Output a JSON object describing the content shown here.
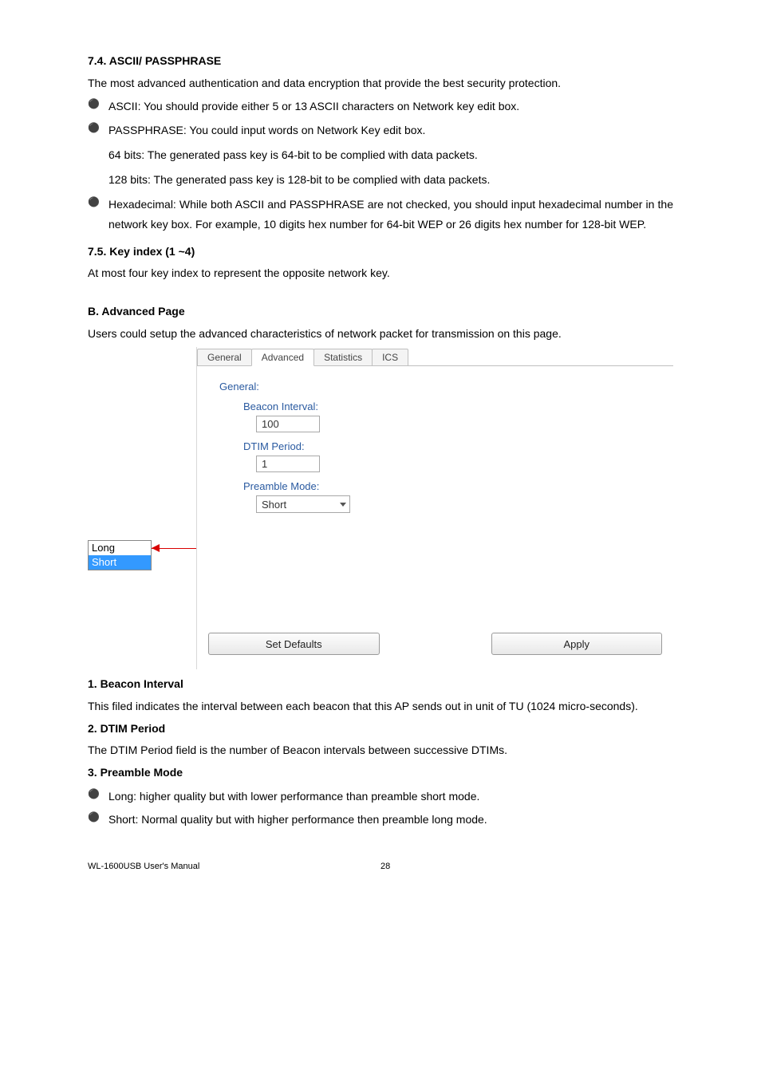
{
  "s74": {
    "heading": "7.4. ASCII/ PASSPHRASE",
    "intro": "The most advanced authentication and data encryption that provide the best security protection.",
    "bullets": {
      "b1": "ASCII: You should provide either 5 or 13 ASCII characters on Network key edit box.",
      "b2": "PASSPHRASE: You could input words on Network Key edit box.",
      "b2a": "64 bits: The generated pass key is 64-bit to be complied with data packets.",
      "b2b": "128 bits: The generated pass key is 128-bit to be complied with data packets.",
      "b3": "Hexadecimal: While both ASCII and PASSPHRASE are not checked, you should input hexadecimal number in the network key box. For example, 10 digits hex number for 64-bit WEP or 26 digits hex number for 128-bit WEP."
    }
  },
  "s75": {
    "heading": "7.5. Key index (1 ~4)",
    "text": "At most four key index to represent the opposite network key."
  },
  "advPage": {
    "heading": "B. Advanced Page",
    "intro": "Users could setup the advanced characteristics of network packet for transmission on this page."
  },
  "figure": {
    "dropdown": {
      "opt1": "Long",
      "opt2": "Short"
    },
    "tabs": {
      "t1": "General",
      "t2": "Advanced",
      "t3": "Statistics",
      "t4": "ICS"
    },
    "groupLabel": "General:",
    "beaconLabel": "Beacon Interval:",
    "beaconValue": "100",
    "dtimLabel": "DTIM Period:",
    "dtimValue": "1",
    "preambleLabel": "Preamble Mode:",
    "preambleValue": "Short",
    "btnDefaults": "Set Defaults",
    "btnApply": "Apply"
  },
  "s1": {
    "heading": "1. Beacon Interval",
    "text": "This filed indicates the interval between each beacon that this AP sends out in unit of TU (1024 micro-seconds)."
  },
  "s2": {
    "heading": "2. DTIM Period",
    "text": "The DTIM Period field is the number of Beacon intervals between successive DTIMs."
  },
  "s3": {
    "heading": "3. Preamble Mode",
    "b1": "Long: higher quality but with lower performance than preamble short mode.",
    "b2": "Short: Normal quality but with higher performance then preamble long mode."
  },
  "footer": {
    "left": "WL-1600USB User's Manual",
    "page": "28"
  }
}
